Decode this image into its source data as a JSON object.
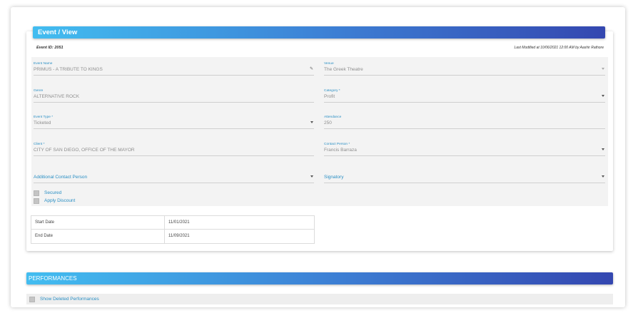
{
  "header": {
    "title": "Event / View"
  },
  "meta": {
    "event_id": "Event ID: 2051",
    "last_modified": "Last Modified at 10/06/2021 12:00 AM by Aashir Rathore"
  },
  "fields": {
    "event_name": {
      "label": "Event Name",
      "value": "PRIMUS - A TRIBUTE TO KINGS"
    },
    "venue": {
      "label": "Venue",
      "value": "The Greek Theatre"
    },
    "genre": {
      "label": "Genre",
      "value": "ALTERNATIVE ROCK"
    },
    "category": {
      "label": "Category *",
      "value": "Profit"
    },
    "event_type": {
      "label": "Event Type *",
      "value": "Ticketed"
    },
    "attendance": {
      "label": "Attendance",
      "value": "250"
    },
    "client": {
      "label": "Client *",
      "value": "CITY OF SAN DIEGO, OFFICE OF THE MAYOR"
    },
    "contact_person": {
      "label": "Contact Person *",
      "value": "Francis Barraza"
    },
    "additional_contact": {
      "label": "Additional Contact Person"
    },
    "signatory": {
      "label": "Signatory"
    }
  },
  "checkboxes": {
    "secured": "Secured",
    "apply_discount": "Apply Discount"
  },
  "dates": {
    "start": {
      "label": "Start Date",
      "value": "11/01/2021"
    },
    "end": {
      "label": "End Date",
      "value": "11/09/2021"
    }
  },
  "performances": {
    "title": "PERFORMANCES",
    "show_deleted": "Show Deleted Performances"
  }
}
